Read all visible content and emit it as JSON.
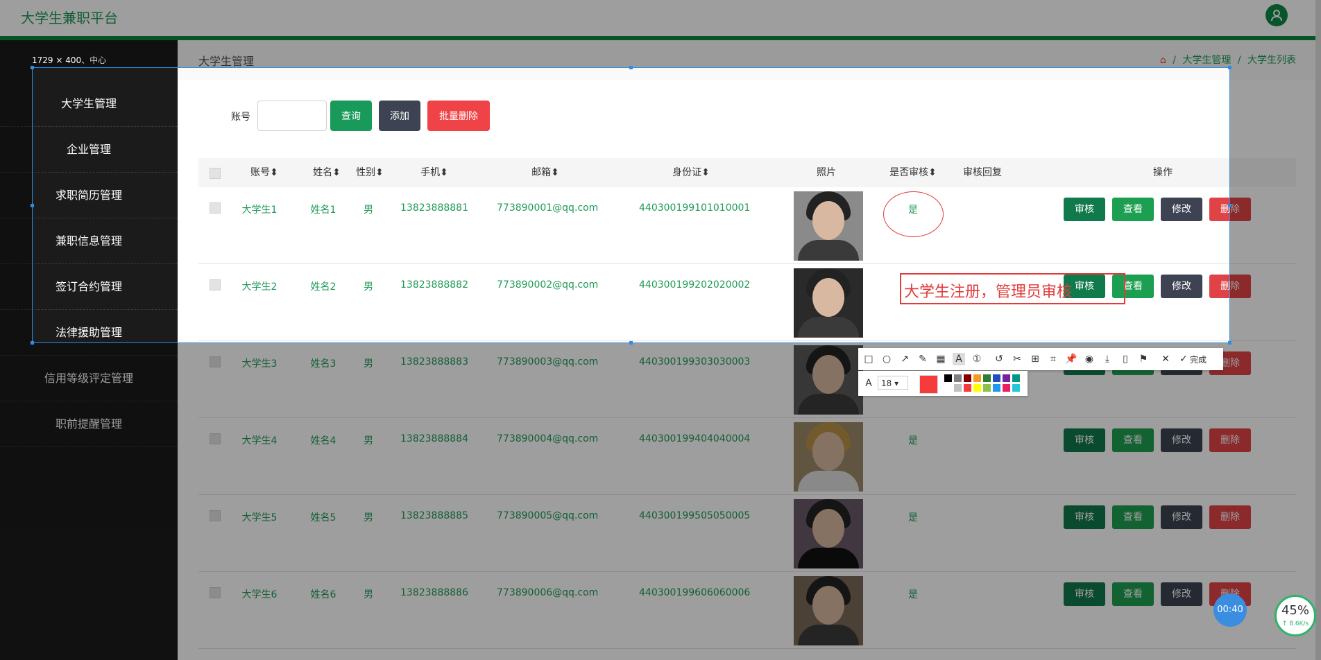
{
  "header": {
    "title": "大学生兼职平台"
  },
  "sidebar": {
    "items": [
      {
        "label": "大学生管理"
      },
      {
        "label": "企业管理"
      },
      {
        "label": "求职简历管理"
      },
      {
        "label": "兼职信息管理"
      },
      {
        "label": "签订合约管理"
      },
      {
        "label": "法律援助管理"
      },
      {
        "label": "信用等级评定管理"
      },
      {
        "label": "职前提醒管理"
      }
    ]
  },
  "page": {
    "title": "大学生管理"
  },
  "breadcrumb": {
    "items": [
      "大学生管理",
      "大学生列表"
    ],
    "separator": "/"
  },
  "search": {
    "account_label": "账号",
    "account_value": "",
    "query_label": "查询",
    "add_label": "添加",
    "batch_delete_label": "批量删除"
  },
  "table": {
    "headers": {
      "account": "账号",
      "name": "姓名",
      "gender": "性别",
      "phone": "手机",
      "email": "邮箱",
      "id_card": "身份证",
      "photo": "照片",
      "audited": "是否审核",
      "reply": "审核回复",
      "actions": "操作"
    },
    "rows": [
      {
        "account": "大学生1",
        "name": "姓名1",
        "gender": "男",
        "phone": "13823888881",
        "email": "773890001@qq.com",
        "id_card": "440300199101010001",
        "audited": "是",
        "reply": ""
      },
      {
        "account": "大学生2",
        "name": "姓名2",
        "gender": "男",
        "phone": "13823888882",
        "email": "773890002@qq.com",
        "id_card": "440300199202020002",
        "audited": "",
        "reply": ""
      },
      {
        "account": "大学生3",
        "name": "姓名3",
        "gender": "男",
        "phone": "13823888883",
        "email": "773890003@qq.com",
        "id_card": "440300199303030003",
        "audited": "",
        "reply": ""
      },
      {
        "account": "大学生4",
        "name": "姓名4",
        "gender": "男",
        "phone": "13823888884",
        "email": "773890004@qq.com",
        "id_card": "440300199404040004",
        "audited": "是",
        "reply": ""
      },
      {
        "account": "大学生5",
        "name": "姓名5",
        "gender": "男",
        "phone": "13823888885",
        "email": "773890005@qq.com",
        "id_card": "440300199505050005",
        "audited": "是",
        "reply": ""
      },
      {
        "account": "大学生6",
        "name": "姓名6",
        "gender": "男",
        "phone": "13823888886",
        "email": "773890006@qq.com",
        "id_card": "440300199606060006",
        "audited": "是",
        "reply": ""
      }
    ],
    "action_labels": {
      "audit": "审核",
      "view": "查看",
      "edit": "修改",
      "delete": "删除"
    }
  },
  "screenshot_tool": {
    "size_label": "1729 × 400",
    "center_label": "中心",
    "annotation_text": "大学生注册，管理员审核",
    "font_size": "18",
    "done_label": "完成",
    "current_color": "#f53b3b",
    "palette": [
      "#000000",
      "#808080",
      "#800000",
      "#f59a23",
      "#2e7d32",
      "#1e4fbf",
      "#7b1fa2",
      "#009688",
      "#ffffff",
      "#c0c0c0",
      "#f53b3b",
      "#ffff00",
      "#8bc34a",
      "#2196f3",
      "#e91e63",
      "#26c6da"
    ]
  },
  "widgets": {
    "timer": "00:40",
    "percent": "45%",
    "speed": "↑ 8.6K/s"
  },
  "colors": {
    "brand": "#1e9a56",
    "header_bar": "#0a8a3e",
    "sidebar": "#1b1b1b",
    "annotation": "#e23b3b"
  }
}
